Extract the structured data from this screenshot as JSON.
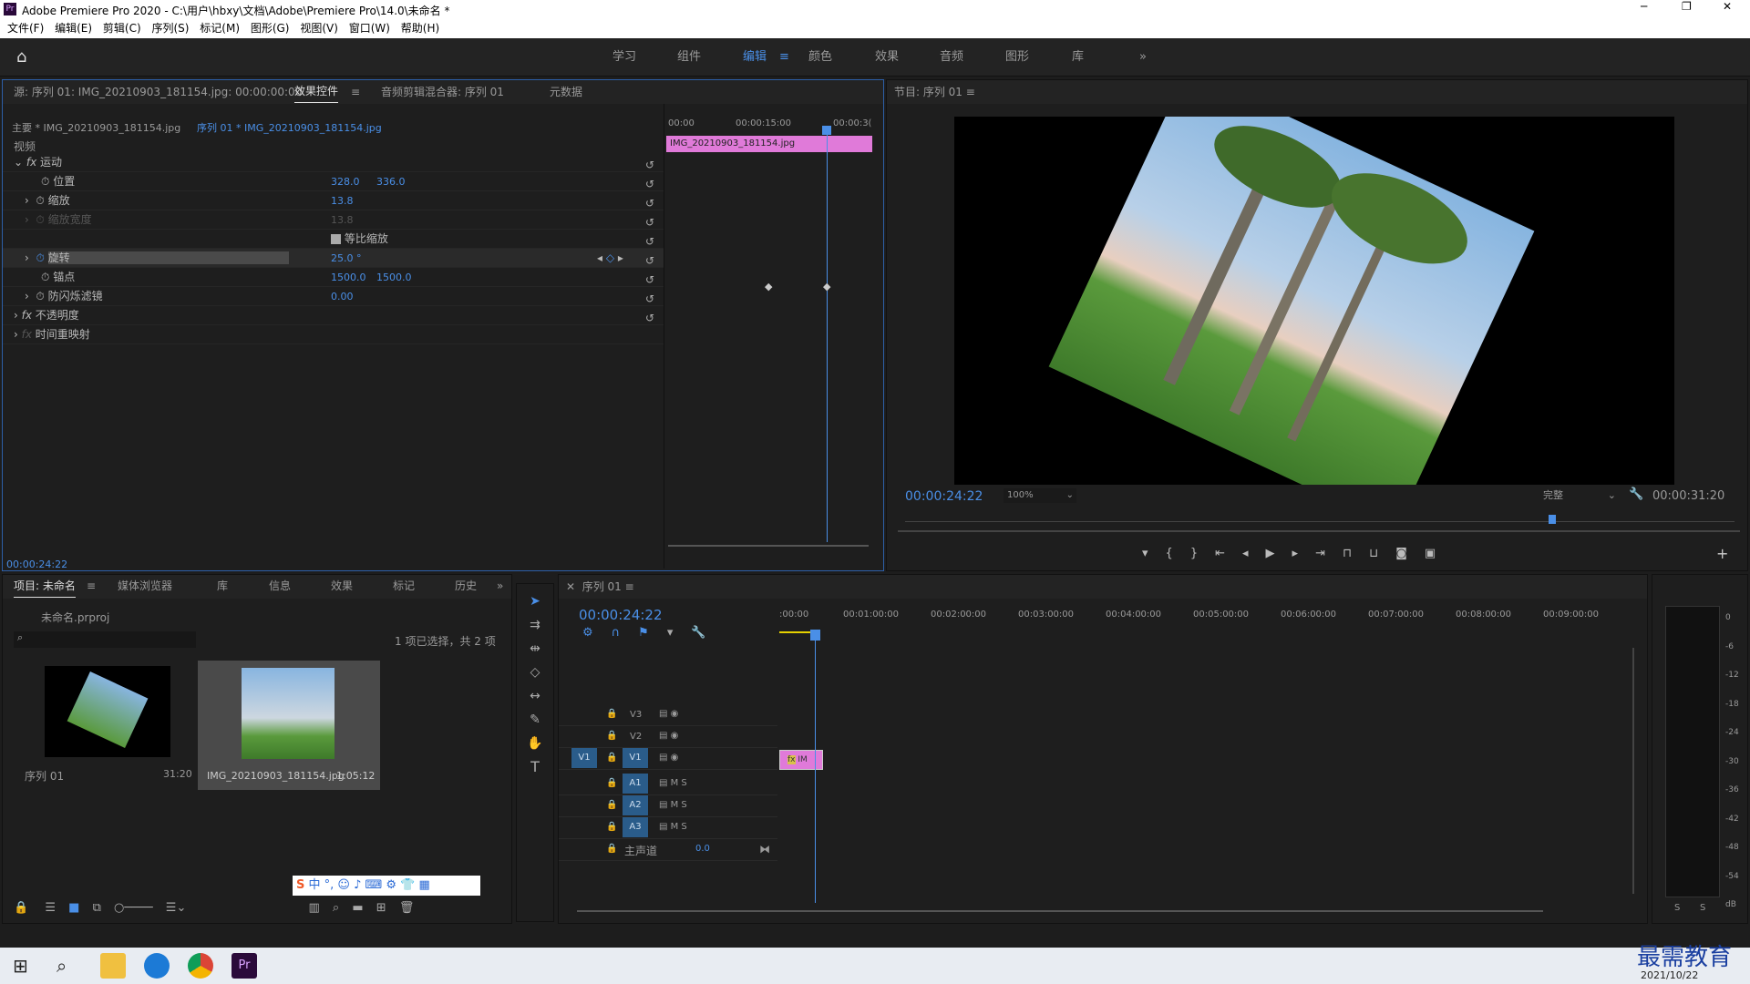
{
  "title": "Adobe Premiere Pro 2020 - C:\\用户\\hbxy\\文档\\Adobe\\Premiere Pro\\14.0\\未命名 *",
  "menu": [
    "文件(F)",
    "编辑(E)",
    "剪辑(C)",
    "序列(S)",
    "标记(M)",
    "图形(G)",
    "视图(V)",
    "窗口(W)",
    "帮助(H)"
  ],
  "workspaces": [
    "学习",
    "组件",
    "编辑",
    "颜色",
    "效果",
    "音频",
    "图形",
    "库"
  ],
  "source_panel": {
    "tabs": [
      "源: 序列 01: IMG_20210903_181154.jpg: 00:00:00:00",
      "效果控件",
      "音频剪辑混合器: 序列 01",
      "元数据"
    ],
    "master": "主要 * IMG_20210903_181154.jpg",
    "seq": "序列 01 * IMG_20210903_181154.jpg",
    "ruler": [
      "00:00",
      "00:00:15:00",
      "00:00:3("
    ],
    "clip_name": "IMG_20210903_181154.jpg",
    "video_label": "视频",
    "timecode": "00:00:24:22",
    "props": [
      {
        "name": "运动",
        "v1": "",
        "v2": ""
      },
      {
        "name": "位置",
        "v1": "328.0",
        "v2": "336.0"
      },
      {
        "name": "缩放",
        "v1": "13.8",
        "v2": ""
      },
      {
        "name": "缩放宽度",
        "v1": "13.8",
        "v2": ""
      },
      {
        "name": "等比缩放",
        "v1": "",
        "v2": ""
      },
      {
        "name": "旋转",
        "v1": "25.0 °",
        "v2": ""
      },
      {
        "name": "锚点",
        "v1": "1500.0",
        "v2": "1500.0"
      },
      {
        "name": "防闪烁滤镜",
        "v1": "0.00",
        "v2": ""
      },
      {
        "name": "不透明度",
        "v1": "",
        "v2": ""
      },
      {
        "name": "时间重映射",
        "v1": "",
        "v2": ""
      }
    ]
  },
  "program": {
    "title": "节目: 序列 01",
    "timecode": "00:00:24:22",
    "zoom": "100%",
    "quality": "完整",
    "duration": "00:00:31:20"
  },
  "project": {
    "tabs": [
      "项目: 未命名",
      "媒体浏览器",
      "库",
      "信息",
      "效果",
      "标记",
      "历史"
    ],
    "file": "未命名.prproj",
    "selected": "1 项已选择，共 2 项",
    "items": [
      {
        "name": "序列 01",
        "dur": "31:20"
      },
      {
        "name": "IMG_20210903_181154.jpg",
        "dur": "1:05:12"
      }
    ]
  },
  "timeline": {
    "title": "序列 01",
    "timecode": "00:00:24:22",
    "ruler": [
      ":00:00",
      "00:01:00:00",
      "00:02:00:00",
      "00:03:00:00",
      "00:04:00:00",
      "00:05:00:00",
      "00:06:00:00",
      "00:07:00:00",
      "00:08:00:00",
      "00:09:00:00"
    ],
    "tracks": [
      "V3",
      "V2",
      "V1",
      "A1",
      "A2",
      "A3"
    ],
    "master": "主声道",
    "master_val": "0.0",
    "clip": "IM"
  },
  "meter": [
    "0",
    "-6",
    "-12",
    "-18",
    "-24",
    "-30",
    "-36",
    "-42",
    "-48",
    "-54",
    "dB"
  ],
  "clock": {
    "date": "2021/10/22"
  },
  "watermark": "最需教育"
}
